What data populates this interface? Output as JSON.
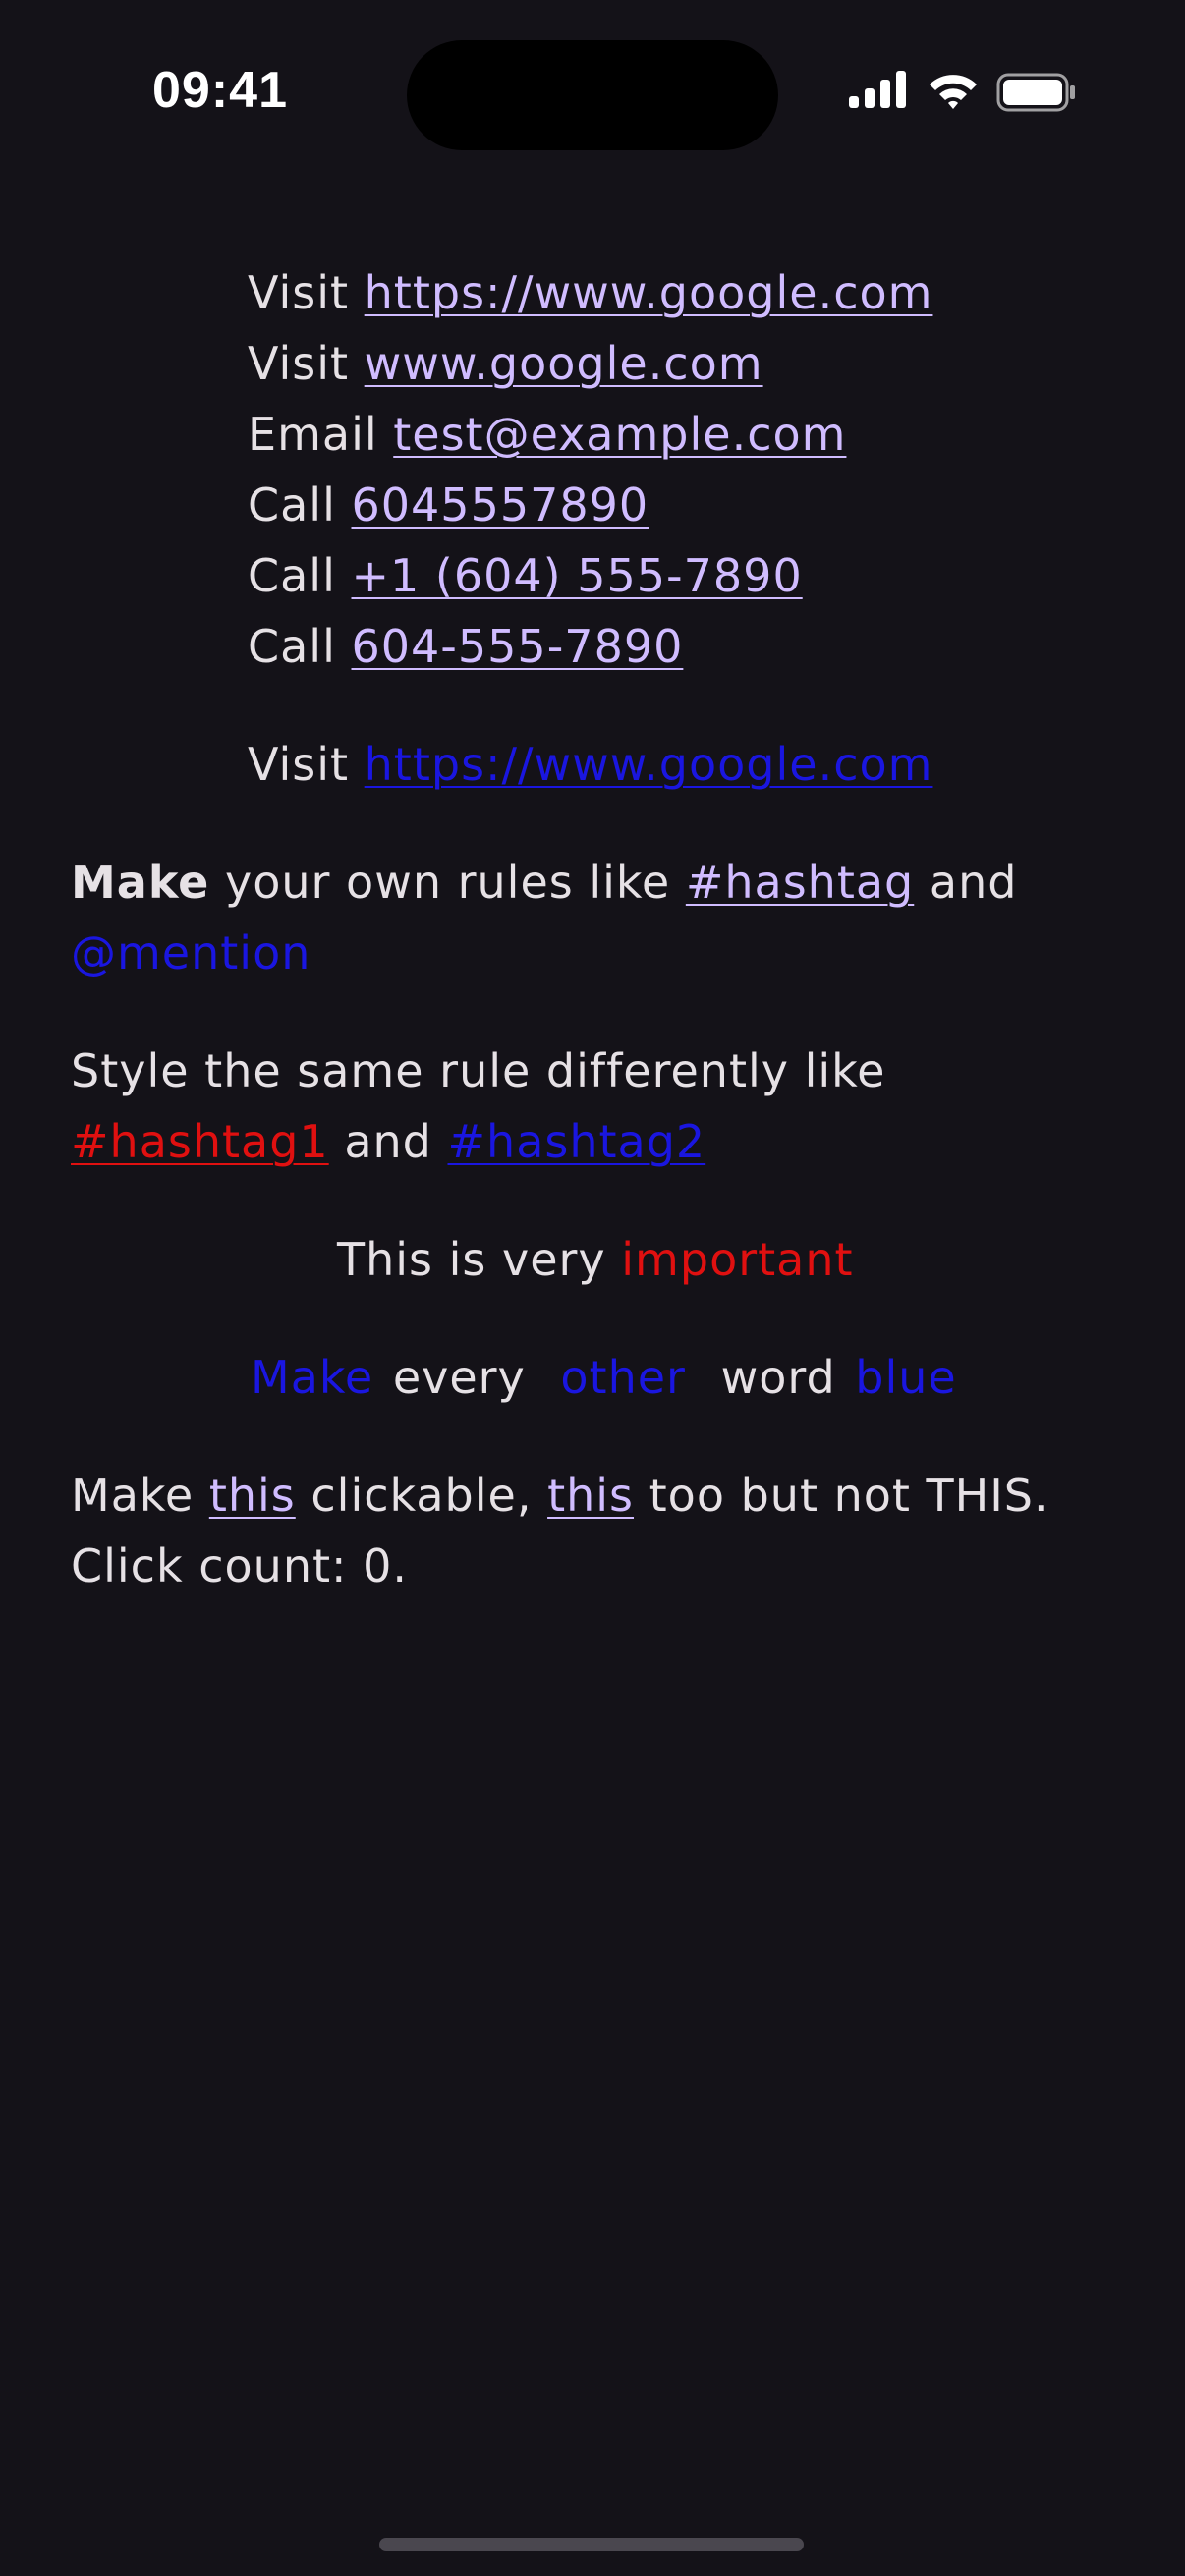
{
  "status_bar": {
    "time": "09:41",
    "icons": [
      "cellular-signal-icon",
      "wifi-icon",
      "battery-icon"
    ]
  },
  "links_block": {
    "rows": [
      {
        "prefix": "Visit",
        "link": "https://www.google.com"
      },
      {
        "prefix": "Visit",
        "link": "www.google.com"
      },
      {
        "prefix": "Email",
        "link": "test@example.com"
      },
      {
        "prefix": "Call",
        "link": "6045557890"
      },
      {
        "prefix": "Call",
        "link": "+1 (604) 555-7890"
      },
      {
        "prefix": "Call",
        "link": "604-555-7890"
      }
    ]
  },
  "styled_link": {
    "prefix": "Visit",
    "link": "https://www.google.com"
  },
  "rules": {
    "bold": "Make",
    "text1": "your own rules like",
    "hashtag": "#hashtag",
    "text2": "and",
    "mention": "@mention"
  },
  "same_rule": {
    "text1": "Style the same rule differently like",
    "hashtag1": "#hashtag1",
    "text2": "and",
    "hashtag2": "#hashtag2"
  },
  "important": {
    "text": "This is very",
    "highlight": "important"
  },
  "every_other": {
    "words": [
      "Make",
      "every",
      "other",
      "word",
      "blue"
    ]
  },
  "clickable": {
    "text1": "Make",
    "link1": "this",
    "text2": "clickable,",
    "link2": "this",
    "text3": "too but not THIS.",
    "count_text": "Click count: 0."
  },
  "colors": {
    "background": "#141218",
    "text": "#e6e1e5",
    "link": "#d0bcff",
    "blue": "#1a16e0",
    "red": "#e01010"
  }
}
